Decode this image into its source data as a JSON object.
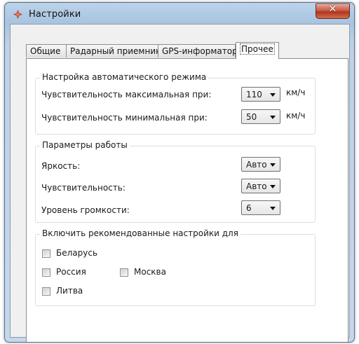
{
  "window": {
    "title": "Настройки",
    "close_glyph": "✕",
    "accent": "#c23a27"
  },
  "tabs": [
    {
      "label": "Общие",
      "active": false
    },
    {
      "label": "Радарный приемник",
      "active": false
    },
    {
      "label": "GPS-информатор",
      "active": false
    },
    {
      "label": "Прочее",
      "active": true
    }
  ],
  "auto_mode": {
    "title": "Настройка автоматического режима",
    "max_label": "Чувствительность максимальная при:",
    "max_value": "110",
    "min_label": "Чувствительность минимальная при:",
    "min_value": "50",
    "unit": "км/ч"
  },
  "work_params": {
    "title": "Параметры работы",
    "brightness_label": "Яркость:",
    "brightness_value": "Авто",
    "sensitivity_label": "Чувствительность:",
    "sensitivity_value": "Авто",
    "volume_label": "Уровень громкости:",
    "volume_value": "6"
  },
  "recommended": {
    "title": "Включить рекомендованные настройки для",
    "belarus": {
      "label": "Беларусь",
      "checked": false
    },
    "russia": {
      "label": "Россия",
      "checked": false
    },
    "moscow": {
      "label": "Москва",
      "checked": false
    },
    "lithuania": {
      "label": "Литва",
      "checked": false
    }
  }
}
